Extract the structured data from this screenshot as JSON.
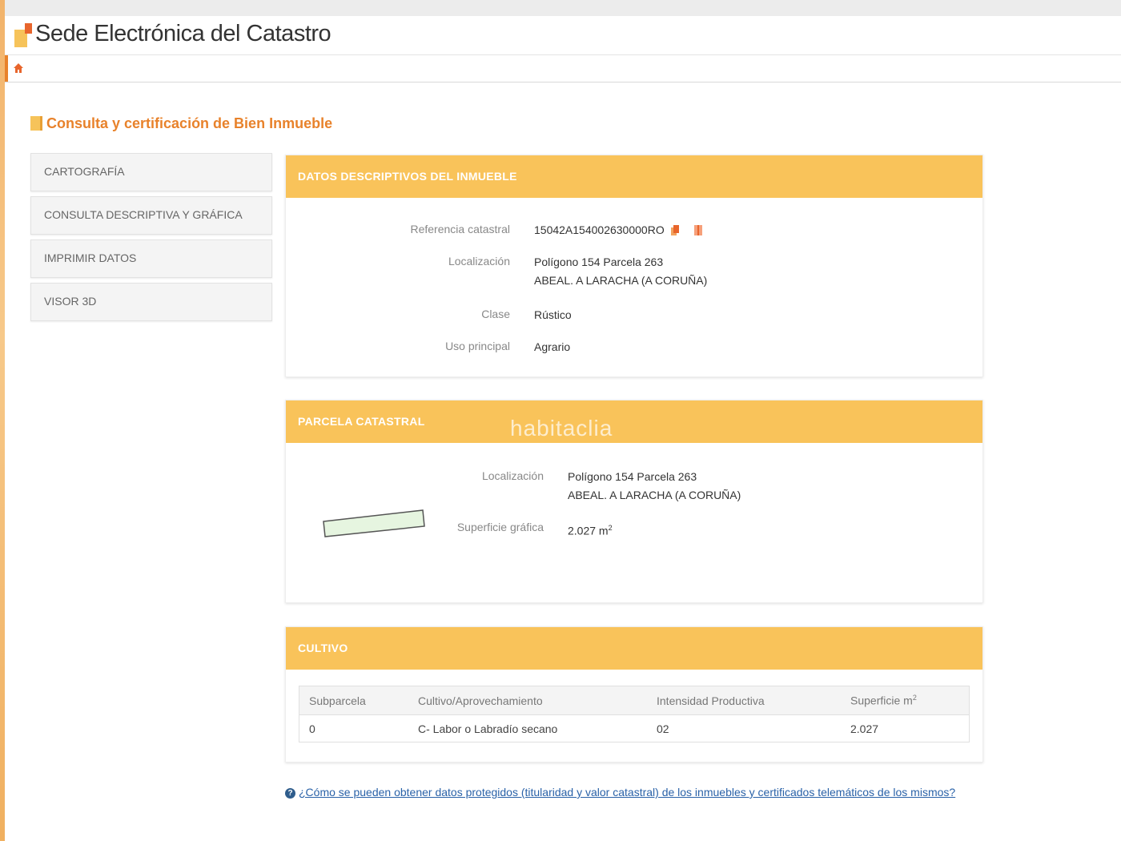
{
  "header": {
    "site_title": "Sede Electrónica del Catastro"
  },
  "page": {
    "heading": "Consulta y certificación de Bien Inmueble"
  },
  "menu": {
    "items": [
      {
        "label": "CARTOGRAFÍA"
      },
      {
        "label": "CONSULTA DESCRIPTIVA Y GRÁFICA"
      },
      {
        "label": "IMPRIMIR DATOS"
      },
      {
        "label": "VISOR 3D"
      }
    ]
  },
  "datos": {
    "title": "DATOS DESCRIPTIVOS DEL INMUEBLE",
    "ref_label": "Referencia catastral",
    "ref_value": "15042A154002630000RO",
    "loc_label": "Localización",
    "loc_line1": "Polígono 154 Parcela 263",
    "loc_line2": "ABEAL. A LARACHA (A CORUÑA)",
    "clase_label": "Clase",
    "clase_value": "Rústico",
    "uso_label": "Uso principal",
    "uso_value": "Agrario"
  },
  "parcela": {
    "title": "PARCELA CATASTRAL",
    "watermark": "habitaclia",
    "loc_label": "Localización",
    "loc_line1": "Polígono 154 Parcela 263",
    "loc_line2": "ABEAL. A LARACHA (A CORUÑA)",
    "sup_label": "Superficie gráfica",
    "sup_value": "2.027 m",
    "sup_unit_exp": "2"
  },
  "cultivo": {
    "title": "CULTIVO",
    "columns": [
      "Subparcela",
      "Cultivo/Aprovechamiento",
      "Intensidad Productiva",
      "Superficie m"
    ],
    "sup_col_exp": "2",
    "rows": [
      [
        "0",
        "C- Labor o Labradío secano",
        "02",
        "2.027"
      ]
    ]
  },
  "help": {
    "icon": "info-icon",
    "link_text": "¿Cómo se pueden obtener datos protegidos (titularidad y valor catastral) de los inmuebles y certificados telemáticos de los mismos?"
  },
  "colors": {
    "accent_orange": "#e8822b",
    "panel_header": "#f9c35a",
    "link_blue": "#2a62a8"
  }
}
